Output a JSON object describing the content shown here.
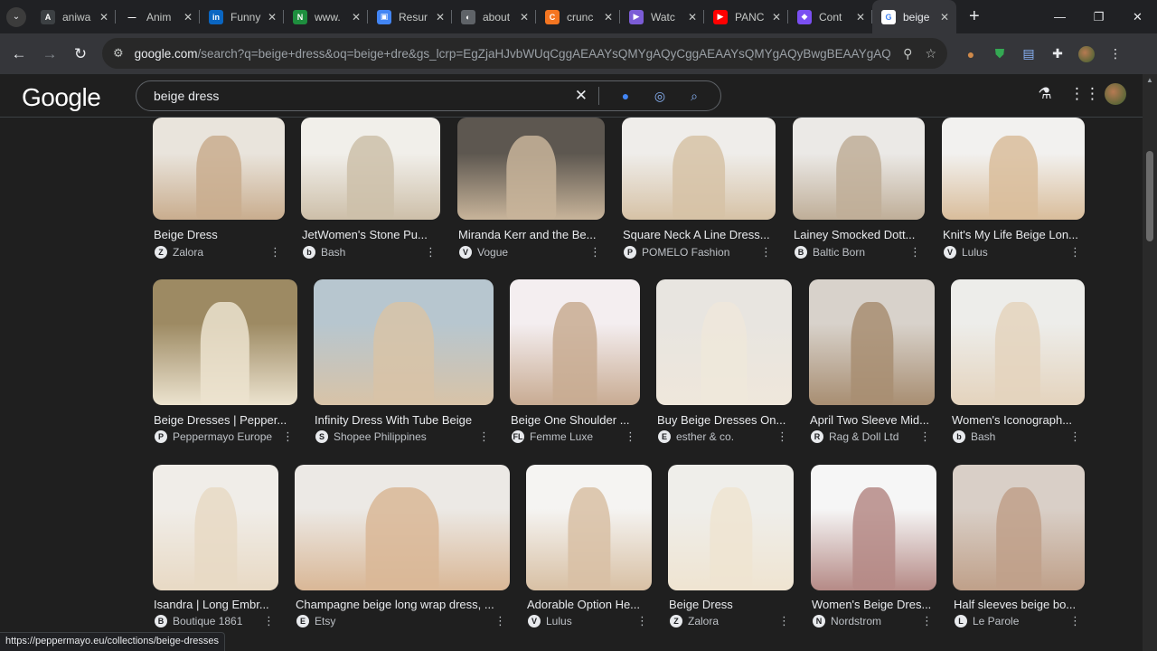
{
  "browser": {
    "tabs": [
      {
        "title": "aniwa",
        "fav_color": "#3c4043",
        "fav_glyph": "A"
      },
      {
        "title": "Anim",
        "fav_color": "#202124",
        "fav_glyph": "—"
      },
      {
        "title": "Funny",
        "fav_color": "#0a66c2",
        "fav_glyph": "in"
      },
      {
        "title": "www.",
        "fav_color": "#1e8e3e",
        "fav_glyph": "N"
      },
      {
        "title": "Resur",
        "fav_color": "#4285f4",
        "fav_glyph": "▣"
      },
      {
        "title": "about",
        "fav_color": "#5f6368",
        "fav_glyph": "◐"
      },
      {
        "title": "crunc",
        "fav_color": "#f47521",
        "fav_glyph": "C"
      },
      {
        "title": "Watc",
        "fav_color": "#7b5cd6",
        "fav_glyph": "▶"
      },
      {
        "title": "PANC",
        "fav_color": "#ff0000",
        "fav_glyph": "▶"
      },
      {
        "title": "Cont",
        "fav_color": "#7a4ff2",
        "fav_glyph": "◆"
      },
      {
        "title": "beige",
        "fav_color": "#ffffff",
        "fav_glyph": "G",
        "active": true
      }
    ],
    "url_main": "google.com",
    "url_rest": "/search?q=beige+dress&oq=beige+dre&gs_lcrp=EgZjaHJvbWUqCggAEAAYsQMYgAQyCggAEAAYsQMYgAQyBwgBEAAYgAQyBgg...",
    "status_url": "https://peppermayo.eu/collections/beige-dresses"
  },
  "google": {
    "logo": "Google",
    "query": "beige dress"
  },
  "rows": [
    [
      {
        "caption": "Beige Dress",
        "source": "Zalora",
        "fav": "Z",
        "colors": [
          "#e9e4dc",
          "#c9ad8e"
        ]
      },
      {
        "caption": "JetWomen's Stone Pu...",
        "source": "Bash",
        "fav": "b",
        "colors": [
          "#f1efea",
          "#cdbfa9"
        ]
      },
      {
        "caption": "Miranda Kerr and the Be...",
        "source": "Vogue",
        "fav": "V",
        "colors": [
          "#5d5750",
          "#c8b49a"
        ]
      },
      {
        "caption": "Square Neck A Line Dress...",
        "source": "POMELO Fashion",
        "fav": "P",
        "colors": [
          "#efedea",
          "#d6c2a6"
        ]
      },
      {
        "caption": "Lainey Smocked Dott...",
        "source": "Baltic Born",
        "fav": "B",
        "colors": [
          "#ebe9e6",
          "#bfae98"
        ]
      },
      {
        "caption": "Knit's My Life Beige Lon...",
        "source": "Lulus",
        "fav": "V",
        "colors": [
          "#f2f1ef",
          "#d9bd9b"
        ]
      }
    ],
    [
      {
        "caption": "Beige Dresses | Pepper...",
        "source": "Peppermayo Europe",
        "fav": "P",
        "colors": [
          "#9d8a63",
          "#ece3cf"
        ]
      },
      {
        "caption": "Infinity Dress With Tube Beige",
        "source": "Shopee Philippines",
        "fav": "S",
        "colors": [
          "#b7c6cf",
          "#d8c3a7"
        ]
      },
      {
        "caption": "Beige One Shoulder ...",
        "source": "Femme Luxe",
        "fav": "FL",
        "colors": [
          "#f4eef0",
          "#c8ab92"
        ]
      },
      {
        "caption": "Buy Beige Dresses On...",
        "source": "esther & co.",
        "fav": "E",
        "colors": [
          "#e8e5e0",
          "#efe7db"
        ]
      },
      {
        "caption": "April Two Sleeve Mid...",
        "source": "Rag & Doll Ltd",
        "fav": "R",
        "colors": [
          "#d8d2cb",
          "#a88e72"
        ]
      },
      {
        "caption": "Women's Iconograph...",
        "source": "Bash",
        "fav": "b",
        "colors": [
          "#ededea",
          "#e4d3bd"
        ]
      }
    ],
    [
      {
        "caption": "Isandra | Long Embr...",
        "source": "Boutique 1861",
        "fav": "B",
        "colors": [
          "#f0ede8",
          "#e8d9c4"
        ]
      },
      {
        "caption": "Champagne beige long wrap dress, ...",
        "source": "Etsy",
        "fav": "E",
        "colors": [
          "#ece9e5",
          "#d9b796"
        ]
      },
      {
        "caption": "Adorable Option He...",
        "source": "Lulus",
        "fav": "V",
        "colors": [
          "#f5f4f2",
          "#d8c0a4"
        ]
      },
      {
        "caption": "Beige Dress",
        "source": "Zalora",
        "fav": "Z",
        "colors": [
          "#efeeea",
          "#efe4d1"
        ]
      },
      {
        "caption": "Women's Beige Dres...",
        "source": "Nordstrom",
        "fav": "N",
        "colors": [
          "#f6f6f6",
          "#b58a86"
        ]
      },
      {
        "caption": "Half sleeves beige bo...",
        "source": "Le Parole",
        "fav": "L",
        "colors": [
          "#d9cfc7",
          "#bfa089"
        ]
      }
    ]
  ]
}
